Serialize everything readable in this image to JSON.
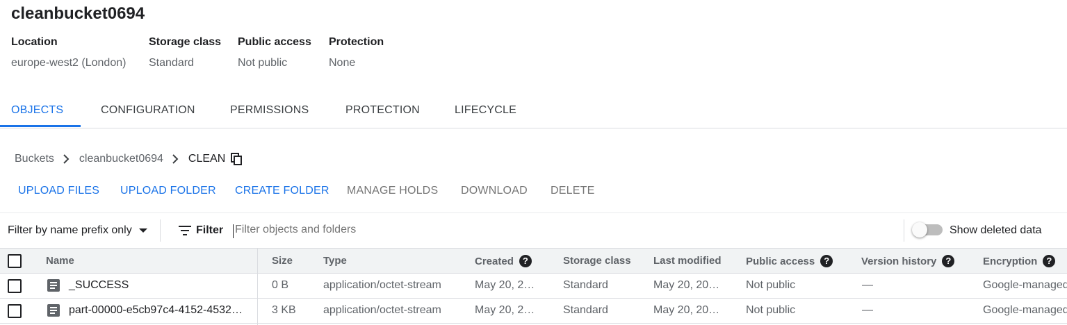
{
  "bucket": {
    "name": "cleanbucket0694"
  },
  "meta": [
    {
      "label": "Location",
      "value": "europe-west2 (London)"
    },
    {
      "label": "Storage class",
      "value": "Standard"
    },
    {
      "label": "Public access",
      "value": "Not public"
    },
    {
      "label": "Protection",
      "value": "None"
    }
  ],
  "tabs": [
    "OBJECTS",
    "CONFIGURATION",
    "PERMISSIONS",
    "PROTECTION",
    "LIFECYCLE"
  ],
  "active_tab": "OBJECTS",
  "breadcrumb": [
    "Buckets",
    "cleanbucket0694",
    "CLEAN"
  ],
  "actions": [
    {
      "label": "UPLOAD FILES",
      "enabled": true
    },
    {
      "label": "UPLOAD FOLDER",
      "enabled": true
    },
    {
      "label": "CREATE FOLDER",
      "enabled": true
    },
    {
      "label": "MANAGE HOLDS",
      "enabled": false
    },
    {
      "label": "DOWNLOAD",
      "enabled": false
    },
    {
      "label": "DELETE",
      "enabled": false
    }
  ],
  "filter": {
    "mode": "Filter by name prefix only",
    "label": "Filter",
    "placeholder": "Filter objects and folders",
    "show_deleted_label": "Show deleted data",
    "show_deleted": false
  },
  "table": {
    "columns": [
      "Name",
      "Size",
      "Type",
      "Created",
      "Storage class",
      "Last modified",
      "Public access",
      "Version history",
      "Encryption"
    ],
    "rows": [
      {
        "name": "_SUCCESS",
        "size": "0 B",
        "type": "application/octet-stream",
        "created": "May 20, 2…",
        "storage_class": "Standard",
        "last_modified": "May 20, 20…",
        "public_access": "Not public",
        "version_history": "—",
        "encryption": "Google-managed"
      },
      {
        "name": "part-00000-e5cb97c4-4152-4532…",
        "size": "3 KB",
        "type": "application/octet-stream",
        "created": "May 20, 2…",
        "storage_class": "Standard",
        "last_modified": "May 20, 20…",
        "public_access": "Not public",
        "version_history": "—",
        "encryption": "Google-managed"
      }
    ]
  },
  "colors": {
    "accent": "#1a73e8",
    "text": "#202124",
    "muted": "#5f6368",
    "header_bg": "#f1f3f4"
  },
  "icons": [
    "chevron-right-icon",
    "copy-icon",
    "dropdown-arrow-icon",
    "filter-icon",
    "help-icon",
    "file-icon",
    "checkbox"
  ]
}
